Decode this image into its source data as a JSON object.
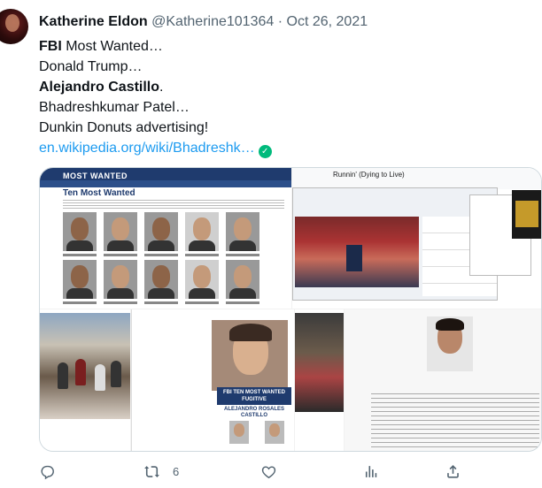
{
  "tweet": {
    "author_name": "Katherine Eldon",
    "handle": "@Katherine101364",
    "separator": "·",
    "date": "Oct 26, 2021",
    "lines": {
      "l1_bold": "FBI",
      "l1_rest": " Most Wanted…",
      "l2": "Donald Trump…",
      "l3_bold": "Alejandro Castillo",
      "l3_rest": ".",
      "l4": "Bhadreshkumar Patel…",
      "l5": "Dunkin Donuts advertising!"
    },
    "link_text": "en.wikipedia.org/wiki/Bhadreshk…",
    "verified_glyph": "✓"
  },
  "media": {
    "fbi": {
      "header": "MOST WANTED",
      "heading": "Ten Most Wanted"
    },
    "wiki_caption": "Runnin' (Dying to Live)",
    "poster": {
      "banner": "FBI TEN MOST WANTED FUGITIVE",
      "name": "ALEJANDRO ROSALES CASTILLO"
    }
  },
  "actions": {
    "reply_icon": "reply-icon",
    "retweet_icon": "retweet-icon",
    "retweet_count": "6",
    "like_icon": "like-icon",
    "views_icon": "views-icon",
    "share_icon": "share-icon"
  },
  "colors": {
    "link": "#1d9bf0",
    "muted": "#536471",
    "verified": "#00ba7c",
    "fbi_blue": "#1f3b6e"
  }
}
